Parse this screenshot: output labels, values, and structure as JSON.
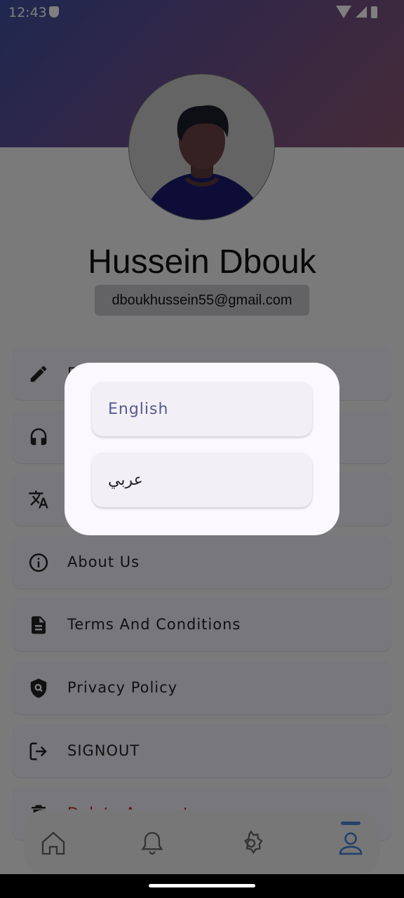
{
  "status_bar": {
    "time": "12:43"
  },
  "profile": {
    "name": "Hussein Dbouk",
    "email": "dboukhussein55@gmail.com"
  },
  "menu": {
    "edit_partial": "E",
    "support_partial": "",
    "language_partial": "",
    "about": "About Us",
    "terms": "Terms And Conditions",
    "privacy": "Privacy Policy",
    "signout": "SIGNOUT",
    "delete": "Delete Account"
  },
  "language_dialog": {
    "options": [
      "English",
      "عربي"
    ]
  },
  "bottom_nav": {
    "items": [
      "home-icon",
      "bell-icon",
      "gear-icon",
      "person-icon"
    ],
    "active_index": 3,
    "accent": "#4b84d8"
  }
}
